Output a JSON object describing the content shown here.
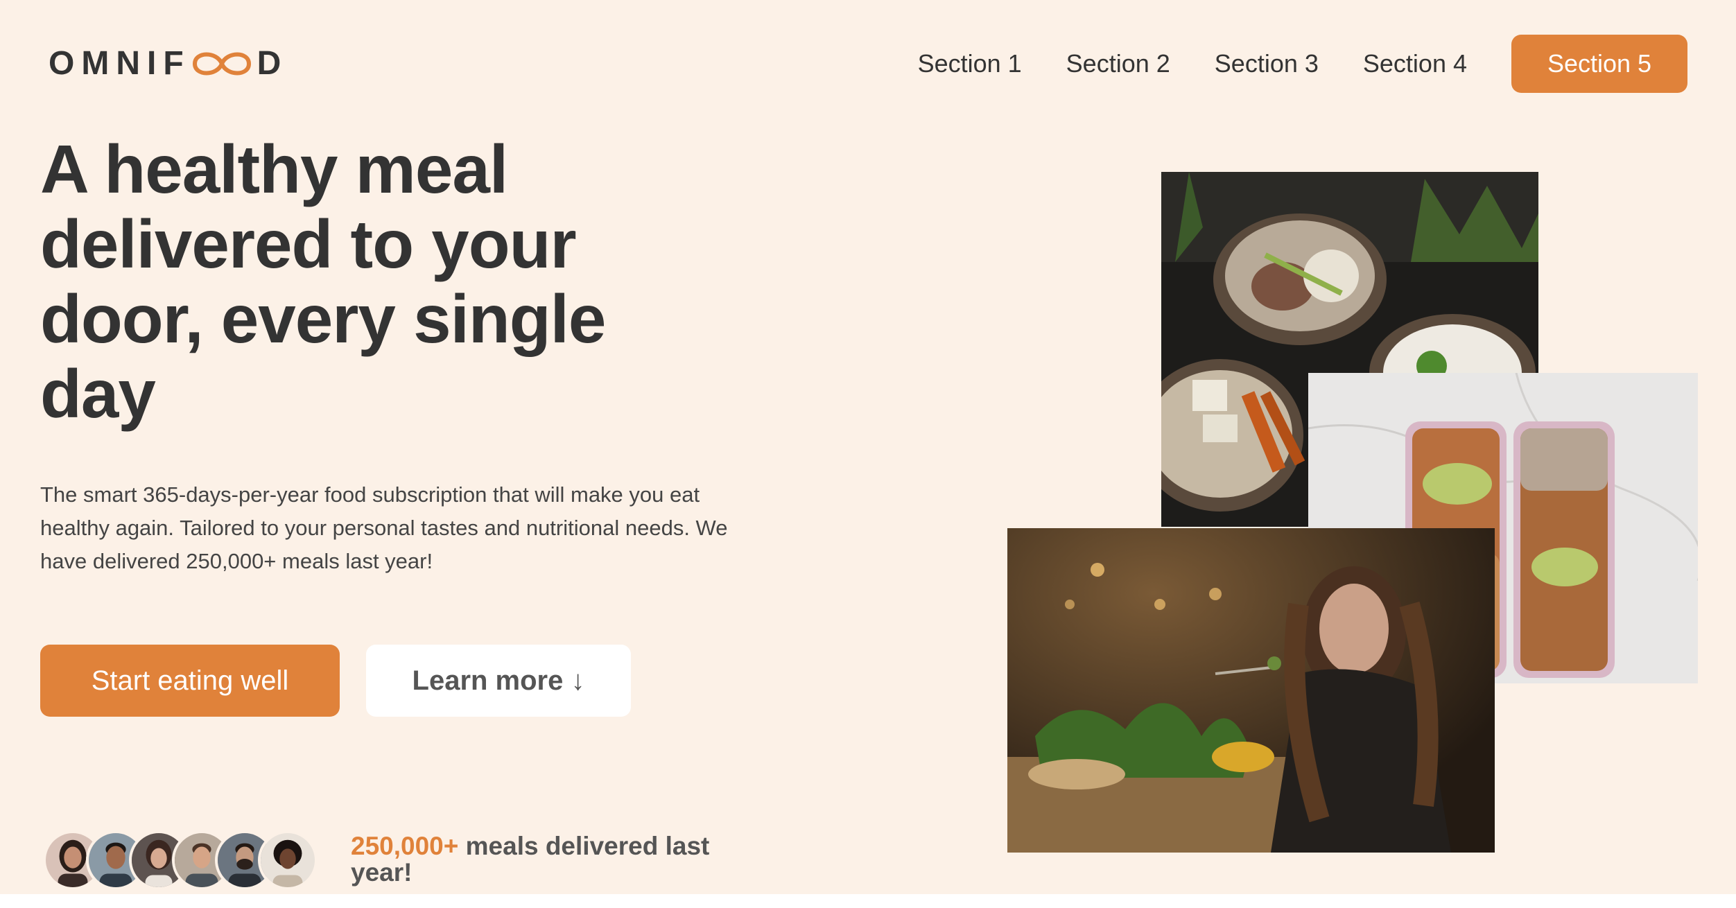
{
  "header": {
    "logo_prefix": "OMNIF",
    "logo_suffix": "D",
    "logo_text": "OMNIFOOD",
    "nav": [
      {
        "label": "Section 1"
      },
      {
        "label": "Section 2"
      },
      {
        "label": "Section 3"
      },
      {
        "label": "Section 4"
      }
    ],
    "cta_label": "Section 5"
  },
  "hero": {
    "title": "A healthy meal delivered to your door, every single day",
    "description": "The smart 365-days-per-year food subscription that will make you eat healthy again. Tailored to your personal tastes and nutritional needs. We have delivered 250,000+ meals last year!",
    "primary_button": "Start eating well",
    "secondary_button": "Learn more ↓"
  },
  "delivered": {
    "count": "250,000+",
    "text": " meals delivered last year!",
    "avatars": [
      "customer-1",
      "customer-2",
      "customer-3",
      "customer-4",
      "customer-5",
      "customer-6"
    ]
  },
  "colors": {
    "accent": "#e0823a",
    "background": "#fcf1e7",
    "text": "#333333"
  }
}
